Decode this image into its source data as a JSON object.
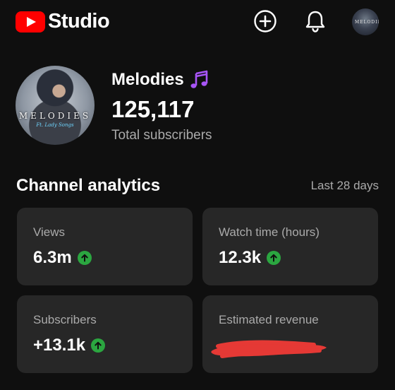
{
  "app": {
    "logo_text": "Studio"
  },
  "topbar": {
    "icons": [
      "create-icon",
      "notifications-icon",
      "account-avatar"
    ]
  },
  "channel": {
    "name": "Melodies",
    "name_emoji": "musical-notes",
    "avatar_text": "MELODIES",
    "avatar_subtext": "Ft. Lady Songs",
    "subscriber_count": "125,117",
    "subscriber_label": "Total subscribers"
  },
  "analytics": {
    "title": "Channel analytics",
    "range": "Last 28 days",
    "cards": [
      {
        "label": "Views",
        "value": "6.3m",
        "trend": "up"
      },
      {
        "label": "Watch time (hours)",
        "value": "12.3k",
        "trend": "up"
      },
      {
        "label": "Subscribers",
        "value": "+13.1k",
        "trend": "up"
      },
      {
        "label": "Estimated revenue",
        "value": "",
        "redacted": true
      }
    ]
  },
  "colors": {
    "background": "#0f0f0f",
    "card": "#272727",
    "brand_red": "#ff0000",
    "trend_green": "#2ba640",
    "redaction": "#e53935"
  }
}
